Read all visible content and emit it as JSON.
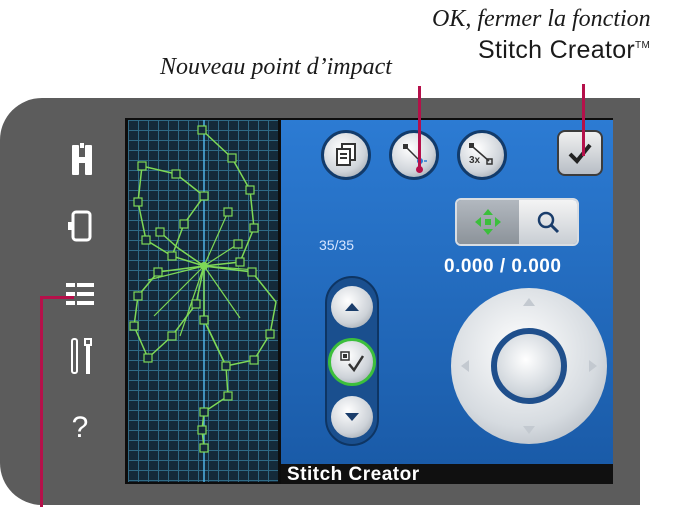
{
  "callouts": {
    "ok_line1": "OK, fermer la fonction",
    "ok_line2": "Stitch Creator",
    "ok_tm": "TM",
    "new_point": "Nouveau point d’impact"
  },
  "sidebar": {
    "items": [
      {
        "icon": "presser-foot-icon",
        "glyph": "H"
      },
      {
        "icon": "hoop-icon"
      },
      {
        "icon": "stitch-menu-icon"
      },
      {
        "icon": "settings-tools-icon"
      },
      {
        "icon": "help-icon",
        "glyph": "?"
      }
    ]
  },
  "panel": {
    "counter": "35/35",
    "coords": "0.000 / 0.000",
    "buttons": [
      {
        "icon": "duplicate-icon"
      },
      {
        "icon": "new-stitch-point-icon"
      },
      {
        "icon": "triple-stitch-icon",
        "label": "3x"
      },
      {
        "icon": "ok-check-icon"
      }
    ]
  },
  "status": {
    "title": "Stitch Creator"
  },
  "colors": {
    "leader": "#b5104a",
    "panel": "#2c7bd3",
    "stitch": "#7ed957"
  }
}
